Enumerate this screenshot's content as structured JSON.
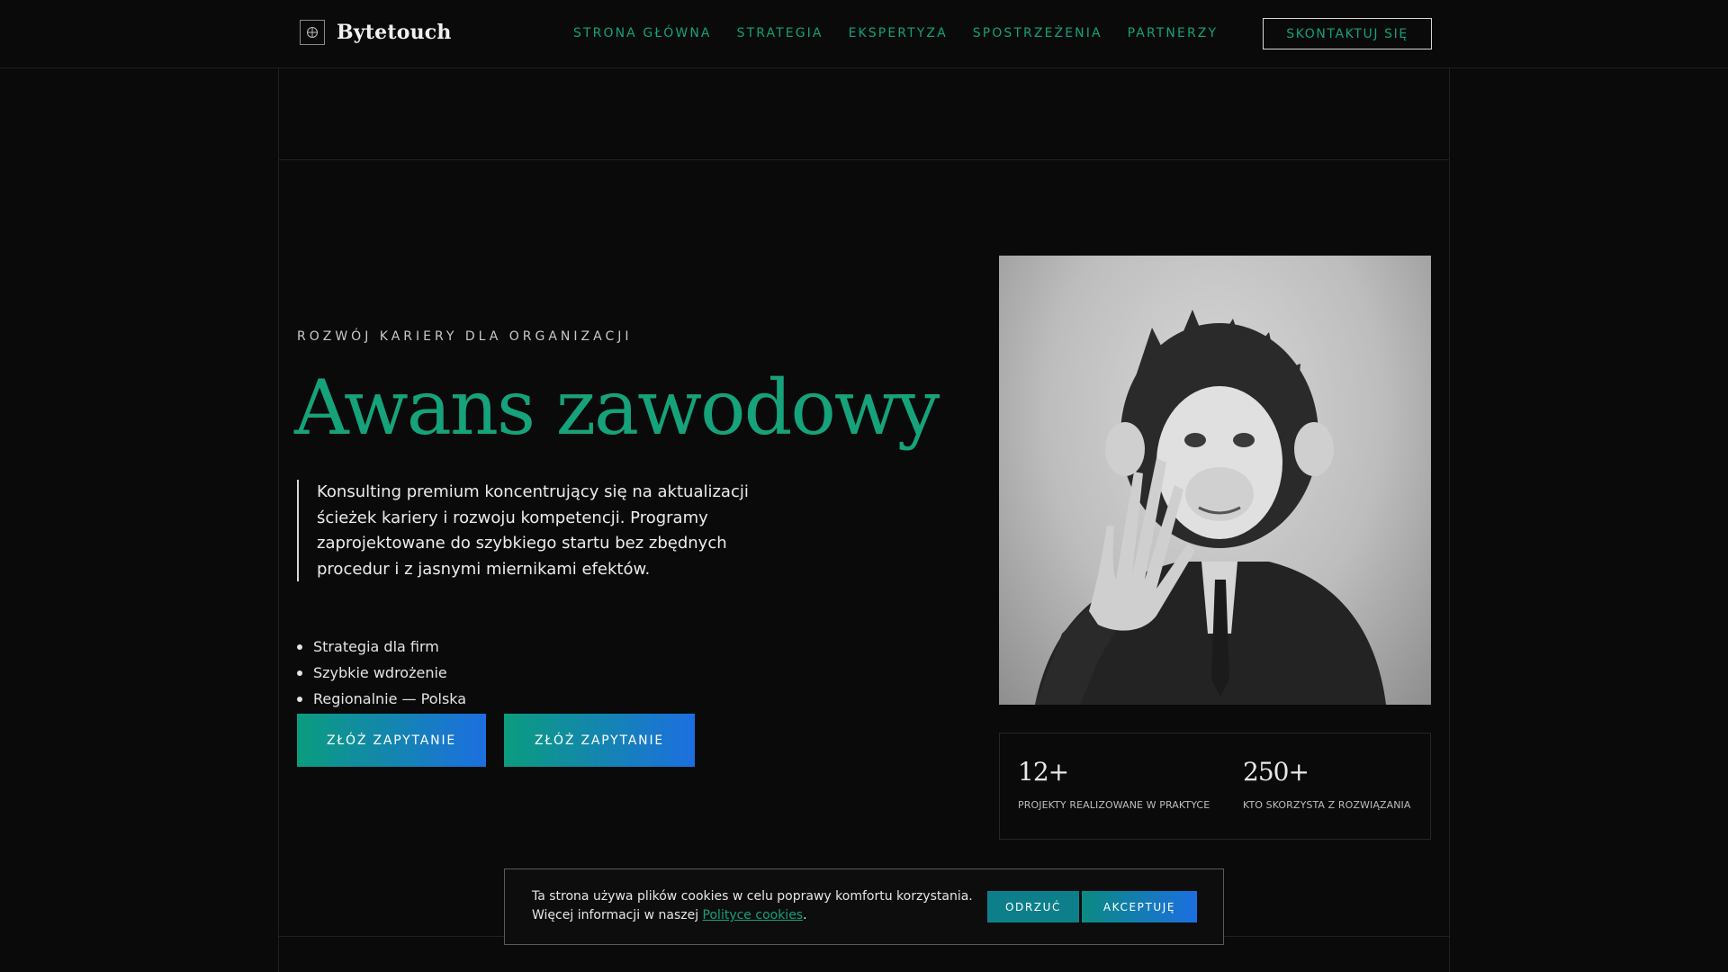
{
  "brand": {
    "name": "Bytetouch",
    "icon": "globe-icon"
  },
  "nav": {
    "items": [
      "STRONA GŁÓWNA",
      "STRATEGIA",
      "EKSPERTYZA",
      "SPOSTRZEŻENIA",
      "PARTNERZY"
    ],
    "contact_label": "SKONTAKTUJ SIĘ"
  },
  "hero": {
    "eyebrow": "ROZWÓJ KARIERY DLA ORGANIZACJI",
    "title": "Awans zawodowy",
    "description": "Konsulting premium koncentrujący się na aktualizacji ścieżek kariery i rozwoju kompetencji. Programy zaprojektowane do szybkiego startu bez zbędnych procedur i z jasnymi miernikami efektów.",
    "bullets": [
      "Strategia dla firm",
      "Szybkie wdrożenie",
      "Regionalnie — Polska"
    ],
    "cta_primary": "ZŁÓŻ ZAPYTANIE",
    "cta_secondary": "ZŁÓŻ ZAPYTANIE"
  },
  "stats": [
    {
      "value": "12+",
      "label": "PROJEKTY REALIZOWANE W PRAKTYCE"
    },
    {
      "value": "250+",
      "label": "KTO SKORZYSTA Z ROZWIĄZANIA"
    }
  ],
  "cookie": {
    "line1": "Ta strona używa plików cookies w celu poprawy komfortu korzystania.",
    "line2_prefix": "Więcej informacji w naszej ",
    "link_text": "Polityce cookies",
    "line2_suffix": ".",
    "reject_label": "ODRZUĆ",
    "accept_label": "AKCEPTUJĘ"
  },
  "colors": {
    "accent": "#16a27a",
    "gradient_start": "#0b9c7e",
    "gradient_end": "#1c6fe0",
    "background": "#0a0a0a"
  }
}
